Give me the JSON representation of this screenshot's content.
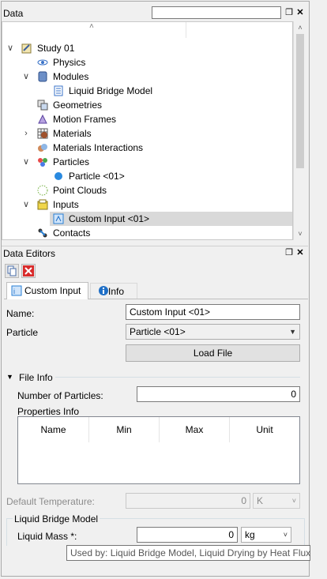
{
  "data_panel": {
    "title": "Data",
    "search_value": "",
    "tree": [
      {
        "label": "Study 01",
        "icon": "study-icon",
        "expander": "v"
      },
      {
        "label": "Physics",
        "icon": "physics-icon"
      },
      {
        "label": "Modules",
        "icon": "modules-icon",
        "expander": "v"
      },
      {
        "label": "Liquid Bridge Model",
        "icon": "document-icon"
      },
      {
        "label": "Geometries",
        "icon": "geometries-icon"
      },
      {
        "label": "Motion Frames",
        "icon": "motion-frames-icon"
      },
      {
        "label": "Materials",
        "icon": "materials-icon",
        "expander": ">"
      },
      {
        "label": "Materials Interactions",
        "icon": "materials-interactions-icon"
      },
      {
        "label": "Particles",
        "icon": "particles-icon",
        "expander": "v"
      },
      {
        "label": "Particle <01>",
        "icon": "particle-dot-icon"
      },
      {
        "label": "Point Clouds",
        "icon": "point-clouds-icon"
      },
      {
        "label": "Inputs",
        "icon": "inputs-icon",
        "expander": "v"
      },
      {
        "label": "Custom Input <01>",
        "icon": "custom-input-icon",
        "selected": true
      },
      {
        "label": "Contacts",
        "icon": "contacts-icon"
      }
    ]
  },
  "editors_panel": {
    "title": "Data Editors",
    "tabs": [
      {
        "label": "Custom Input",
        "active": true
      },
      {
        "label": "Info",
        "active": false
      }
    ],
    "name_label": "Name:",
    "name_value": "Custom Input <01>",
    "particle_label": "Particle",
    "particle_value": "Particle <01>",
    "load_file_label": "Load File",
    "file_info": {
      "section_label": "File Info",
      "num_particles_label": "Number of Particles:",
      "num_particles_value": "0",
      "properties_label": "Properties Info",
      "columns": [
        "Name",
        "Min",
        "Max",
        "Unit"
      ]
    },
    "default_temperature": {
      "label": "Default Temperature:",
      "value": "0",
      "unit": "K"
    },
    "liquid_bridge": {
      "group_label": "Liquid Bridge Model",
      "mass_label": "Liquid Mass *:",
      "mass_value": "0",
      "mass_unit": "kg"
    },
    "tooltip": "Used by: Liquid Bridge Model, Liquid Drying by Heat Flux"
  },
  "colors": {
    "selection": "#d9d9d9",
    "accent_blue": "#1f6fc6",
    "delete_red": "#d92b2b"
  }
}
